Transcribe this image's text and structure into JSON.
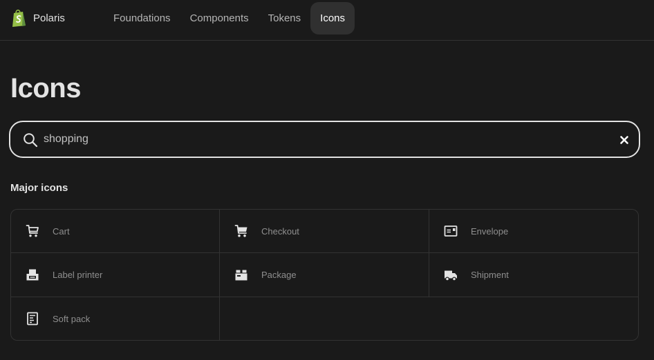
{
  "brand": {
    "name": "Polaris",
    "logo_icon": "shopify-bag-logo"
  },
  "nav": {
    "items": [
      {
        "label": "Foundations",
        "active": false
      },
      {
        "label": "Components",
        "active": false
      },
      {
        "label": "Tokens",
        "active": false
      },
      {
        "label": "Icons",
        "active": true
      }
    ]
  },
  "page": {
    "title": "Icons"
  },
  "search": {
    "value": "shopping",
    "icon": "search-icon",
    "clear_icon": "close-icon"
  },
  "results": {
    "section_heading": "Major icons",
    "items": [
      {
        "label": "Cart",
        "icon": "cart-icon"
      },
      {
        "label": "Checkout",
        "icon": "checkout-icon"
      },
      {
        "label": "Envelope",
        "icon": "envelope-icon"
      },
      {
        "label": "Label printer",
        "icon": "label-printer-icon"
      },
      {
        "label": "Package",
        "icon": "package-icon"
      },
      {
        "label": "Shipment",
        "icon": "shipment-icon"
      },
      {
        "label": "Soft pack",
        "icon": "soft-pack-icon"
      }
    ]
  },
  "colors": {
    "background": "#1a1a1a",
    "active_tab": "#303030",
    "border": "#333333",
    "brand_green": "#95bf47"
  }
}
